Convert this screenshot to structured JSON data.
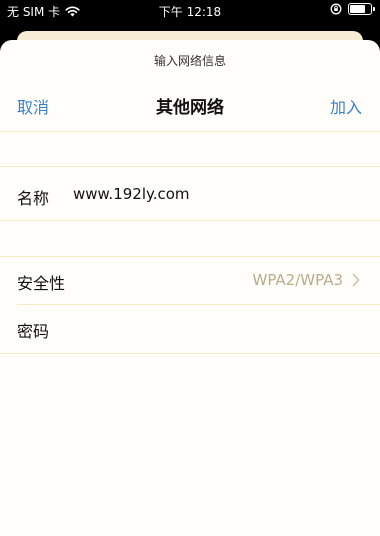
{
  "status_bar": {
    "carrier": "无 SIM 卡",
    "time": "下午 12:18"
  },
  "sheet": {
    "prompt": "输入网络信息",
    "cancel_label": "取消",
    "title": "其他网络",
    "join_label": "加入"
  },
  "form": {
    "name_label": "名称",
    "name_value": "www.192ly.com",
    "security_label": "安全性",
    "security_value": "WPA2/WPA3",
    "password_label": "密码"
  },
  "colors": {
    "accent": "#3a82c8",
    "background": "#fffefb",
    "separator": "#f5ecc5",
    "secondary_text": "#b8ac88"
  }
}
